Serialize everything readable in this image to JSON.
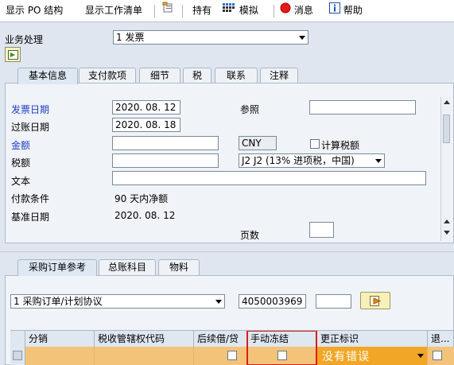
{
  "toolbar": {
    "po_structure": "显示 PO 结构",
    "worklist": "显示工作清单",
    "hold": "持有",
    "simulate": "模拟",
    "messages": "消息",
    "help": "帮助"
  },
  "business": {
    "label": "业务处理",
    "value": "1 发票"
  },
  "header_tabs": [
    "基本信息",
    "支付款项",
    "细节",
    "税",
    "联系",
    "注释"
  ],
  "basic": {
    "invoice_date_label": "发票日期",
    "invoice_date": "2020. 08. 12",
    "reference_label": "参照",
    "reference": "",
    "posting_date_label": "过账日期",
    "posting_date": "2020. 08. 18",
    "amount_label": "金额",
    "amount": "",
    "currency": "CNY",
    "calc_tax_label": "计算税额",
    "tax_label": "税额",
    "tax_amount": "",
    "tax_code": "J2 J2 (13% 进项税，中国)",
    "text_label": "文本",
    "text": "",
    "payment_terms_label": "付款条件",
    "payment_terms": "90 天内净额",
    "baseline_date_label": "基准日期",
    "baseline_date": "2020. 08. 12",
    "page_label": "页数",
    "page": ""
  },
  "item_tabs": [
    "采购订单参考",
    "总账科目",
    "物料"
  ],
  "po_ref": {
    "type": "1 采购订单/计划协议",
    "po_number": "4050003969",
    "item": ""
  },
  "table": {
    "columns": [
      "分销",
      "税收管辖权代码",
      "后续借/贷",
      "手动冻结",
      "更正标识",
      "退..."
    ],
    "row": {
      "correction": "没有错误"
    }
  },
  "colors": {
    "highlight_border": "#d81e1e",
    "row_selected": "#f3c37a",
    "dropdown_orange": "#f2a626",
    "label_blue": "#1c40c8"
  }
}
